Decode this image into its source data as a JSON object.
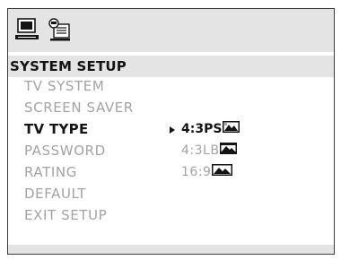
{
  "toolbar": {
    "icons": [
      "computer-icon",
      "settings-icon"
    ]
  },
  "section": {
    "title": "SYSTEM SETUP"
  },
  "menu": {
    "items": [
      {
        "label": "TV SYSTEM",
        "active": false
      },
      {
        "label": "SCREEN SAVER",
        "active": false
      },
      {
        "label": "TV TYPE",
        "active": true
      },
      {
        "label": "PASSWORD",
        "active": false
      },
      {
        "label": "RATING",
        "active": false
      },
      {
        "label": "DEFAULT",
        "active": false
      },
      {
        "label": "EXIT SETUP",
        "active": false
      }
    ]
  },
  "tv_type_options": {
    "selected_index": 0,
    "items": [
      {
        "label": "4:3PS",
        "icon": "pan-scan-thumbnail-icon"
      },
      {
        "label": "4:3LB",
        "icon": "letterbox-thumbnail-icon"
      },
      {
        "label": "16:9",
        "icon": "widescreen-thumbnail-icon"
      }
    ]
  },
  "colors": {
    "panel_gray": "#e4e4e4",
    "text_active": "#141414",
    "text_inactive": "#a3a3a3"
  }
}
